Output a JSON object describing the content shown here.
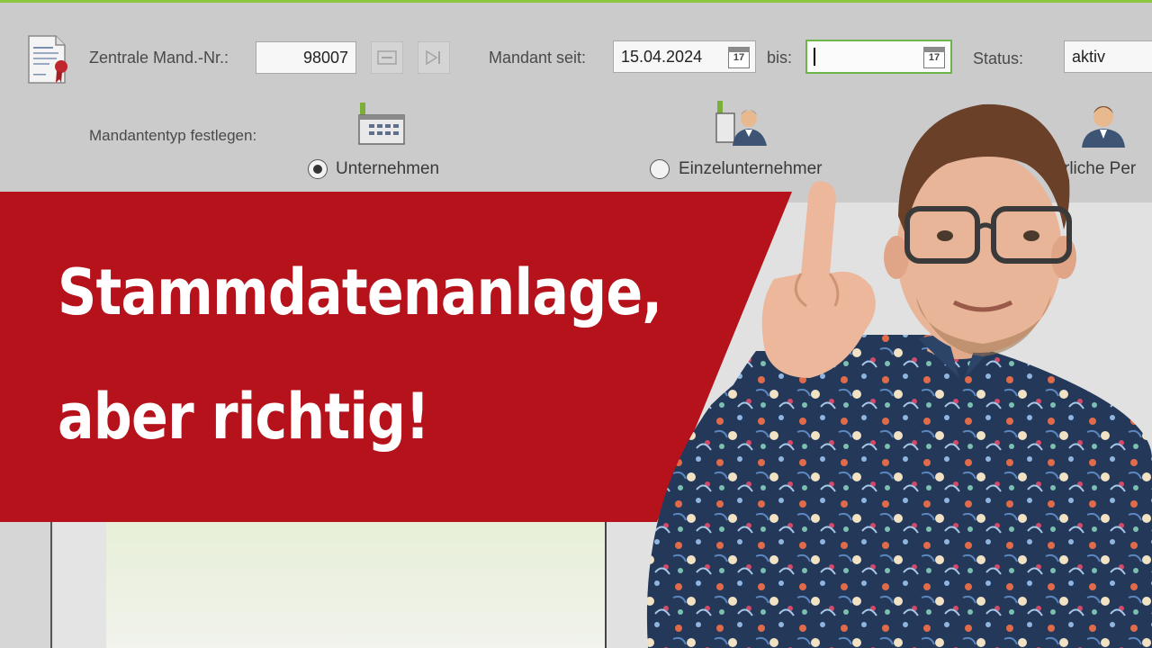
{
  "form": {
    "central_no_label": "Zentrale Mand.-Nr.:",
    "central_no_value": "98007",
    "client_since_label": "Mandant seit:",
    "client_since_value": "15.04.2024",
    "until_label": "bis:",
    "until_value": "",
    "calendar_day": "17",
    "status_label": "Status:",
    "status_value": "aktiv",
    "type_label": "Mandantentyp festlegen:",
    "types": [
      {
        "label": "Unternehmen",
        "checked": true
      },
      {
        "label": "Einzelunternehmer",
        "checked": false
      },
      {
        "label": "rliche Per",
        "checked": false
      }
    ]
  },
  "banner": {
    "line1": "Stammdatenanlage,",
    "line2": "aber richtig!",
    "color": "#b5121b"
  },
  "colors": {
    "accent_green": "#8cc63f",
    "strip_gray": "#cbcbcb"
  },
  "icons": [
    "certificate-document-icon",
    "calendar-icon",
    "company-building-icon",
    "sole-proprietor-icon",
    "person-icon"
  ]
}
